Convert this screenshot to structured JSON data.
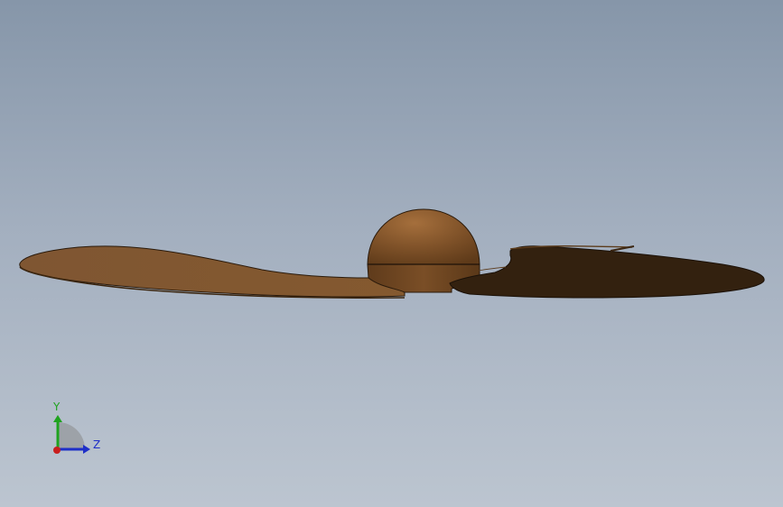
{
  "viewport": {
    "background_top": "#8696a9",
    "background_bottom": "#bcc5d0"
  },
  "model": {
    "part": "propeller",
    "blade_color": "#7d5530",
    "blade_shadow_color": "#33210f",
    "hub_color": "#8a5a2e",
    "edge_color": "#2a1a0b"
  },
  "triad": {
    "y_label": "Y",
    "z_label": "Z",
    "y_color": "#1fa31f",
    "z_color": "#1e2fc8",
    "x_color": "#c81e1e"
  }
}
